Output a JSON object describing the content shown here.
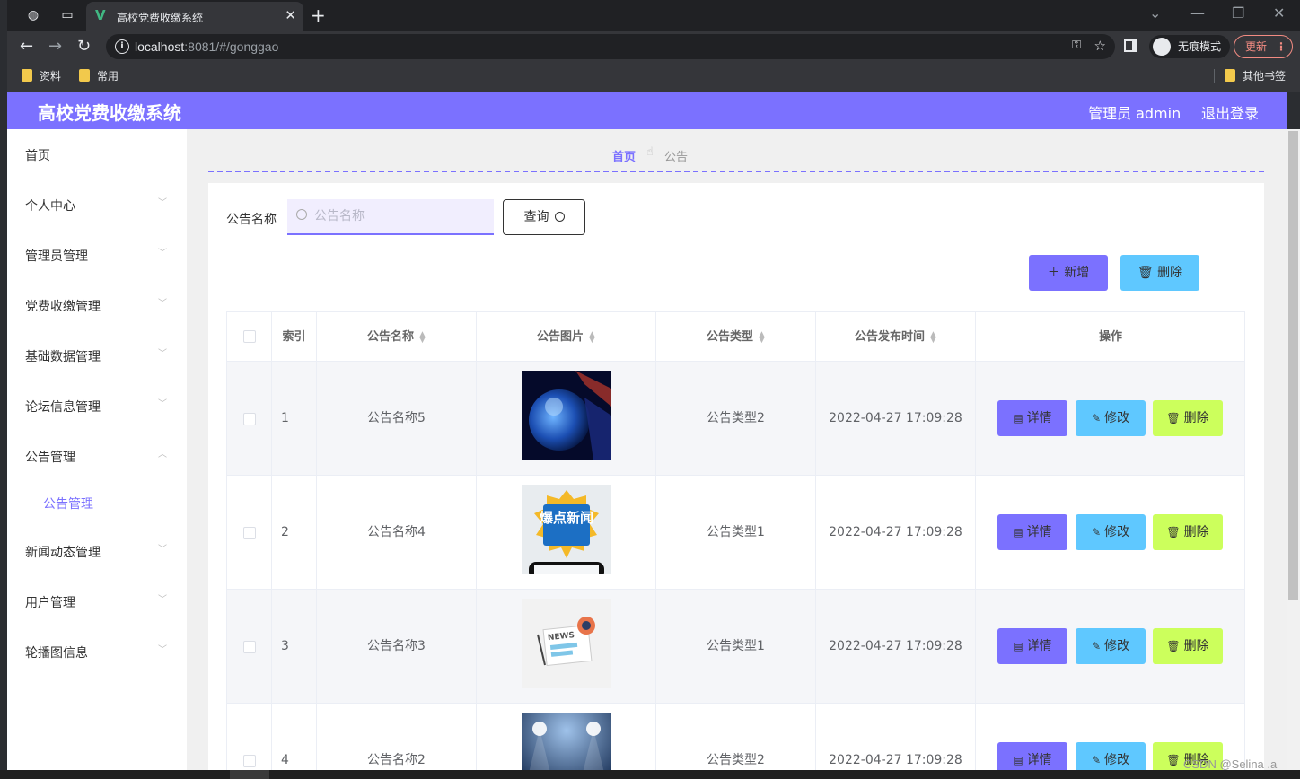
{
  "browser": {
    "tab_title": "高校党费收缴系统",
    "url_host": "localhost",
    "url_rest": ":8081/#/gonggao",
    "incognito_label": "无痕模式",
    "update_label": "更新",
    "bookmarks": [
      {
        "label": "资料"
      },
      {
        "label": "常用"
      }
    ],
    "other_bookmarks": "其他书签"
  },
  "header": {
    "title": "高校党费收缴系统",
    "user": "管理员 admin",
    "logout": "退出登录"
  },
  "sidebar": {
    "items": [
      {
        "label": "首页",
        "has_chevron": false,
        "expanded": false
      },
      {
        "label": "个人中心",
        "has_chevron": true,
        "expanded": false
      },
      {
        "label": "管理员管理",
        "has_chevron": true,
        "expanded": false
      },
      {
        "label": "党费收缴管理",
        "has_chevron": true,
        "expanded": false
      },
      {
        "label": "基础数据管理",
        "has_chevron": true,
        "expanded": false
      },
      {
        "label": "论坛信息管理",
        "has_chevron": true,
        "expanded": false
      },
      {
        "label": "公告管理",
        "has_chevron": true,
        "expanded": true
      },
      {
        "label": "公告管理",
        "sub": true
      },
      {
        "label": "新闻动态管理",
        "has_chevron": true,
        "expanded": false
      },
      {
        "label": "用户管理",
        "has_chevron": true,
        "expanded": false
      },
      {
        "label": "轮播图信息",
        "has_chevron": true,
        "expanded": false
      }
    ]
  },
  "breadcrumb": {
    "home": "首页",
    "current": "公告"
  },
  "search": {
    "label": "公告名称",
    "placeholder": "公告名称",
    "query_button": "查询"
  },
  "actions": {
    "add": "新增",
    "delete": "删除"
  },
  "table": {
    "columns": [
      "索引",
      "公告名称",
      "公告图片",
      "公告类型",
      "公告发布时间",
      "操作"
    ],
    "rows": [
      {
        "index": "1",
        "name": "公告名称5",
        "type": "公告类型2",
        "time": "2022-04-27 17:09:28"
      },
      {
        "index": "2",
        "name": "公告名称4",
        "type": "公告类型1",
        "time": "2022-04-27 17:09:28"
      },
      {
        "index": "3",
        "name": "公告名称3",
        "type": "公告类型1",
        "time": "2022-04-27 17:09:28"
      },
      {
        "index": "4",
        "name": "公告名称2",
        "type": "公告类型2",
        "time": "2022-04-27 17:09:28"
      }
    ],
    "row_actions": {
      "detail": "详情",
      "edit": "修改",
      "delete": "删除"
    }
  },
  "image_text": {
    "row2": "爆点新闻",
    "row3": "NEWS"
  },
  "watermark": "CSDN @Selina .a",
  "colors": {
    "accent": "#7b71ff",
    "cyan": "#5fc8ff",
    "lime": "#ccff5c"
  }
}
